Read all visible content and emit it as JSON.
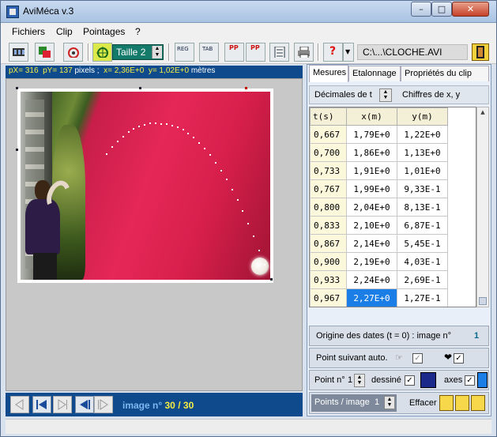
{
  "window": {
    "title": "AviMéca v.3"
  },
  "menu": {
    "items": [
      "Fichiers",
      "Clip",
      "Pointages",
      "?"
    ]
  },
  "toolbar": {
    "taille_label": "Taille",
    "taille_value": "2",
    "file_path": "C:\\...\\CLOCHE.AVI",
    "buttons": [
      "film-strip-icon",
      "copy-icon",
      "target-zoom-icon",
      "crosshair-icon",
      "reg-icon",
      "tab-icon",
      "pp-grid-icon",
      "pp-chart-icon",
      "document-icon",
      "print-icon",
      "help-icon",
      "dropdown-icon",
      "exit-door-icon"
    ],
    "reg_label": "REG",
    "tab_label": "TAB",
    "pp_label": "PP",
    "help_label": "?"
  },
  "coords": {
    "px_label": "pX=",
    "px": "316",
    "py_label": "pY=",
    "py": "137",
    "px_unit": "pixels",
    "separator": ";",
    "x_label": "x=",
    "x": "2,36E+0",
    "y_label": "y=",
    "y": "1,02E+0",
    "xy_unit": "mètres"
  },
  "navigation": {
    "image_label": "image n°",
    "current": "30",
    "separator": "/",
    "total": "30"
  },
  "panel": {
    "tabs": [
      "Mesures",
      "Etalonnage",
      "Propriétés du clip"
    ],
    "active_tab": "Mesures",
    "decimales_label": "Décimales de t",
    "chiffres_label": "Chiffres de x, y",
    "table": {
      "headers": [
        "t(s)",
        "x(m)",
        "y(m)"
      ],
      "rows": [
        [
          "0,667",
          "1,79E+0",
          "1,22E+0"
        ],
        [
          "0,700",
          "1,86E+0",
          "1,13E+0"
        ],
        [
          "0,733",
          "1,91E+0",
          "1,01E+0"
        ],
        [
          "0,767",
          "1,99E+0",
          "9,33E-1"
        ],
        [
          "0,800",
          "2,04E+0",
          "8,13E-1"
        ],
        [
          "0,833",
          "2,10E+0",
          "6,87E-1"
        ],
        [
          "0,867",
          "2,14E+0",
          "5,45E-1"
        ],
        [
          "0,900",
          "2,19E+0",
          "4,03E-1"
        ],
        [
          "0,933",
          "2,24E+0",
          "2,69E-1"
        ],
        [
          "0,967",
          "2,27E+0",
          "1,27E-1"
        ]
      ],
      "selected_cell": "2,27E+0"
    },
    "origine": {
      "label": "Origine des dates (t = 0) : image n°",
      "value": "1"
    },
    "point_suivant": {
      "label": "Point suivant auto.",
      "checked": true
    },
    "point": {
      "label": "Point n°",
      "value": "1",
      "dessine_label": "dessiné",
      "dessine_checked": true,
      "axes_label": "axes",
      "axes_checked": true
    },
    "points_per_image": {
      "label": "Points / image",
      "value": "1"
    },
    "effacer_label": "Effacer"
  },
  "colors": {
    "accent_blue": "#0e4a8c",
    "coord_highlight": "#f6ee42",
    "selected_cell": "#1a7ee6",
    "curtain_red": "#e52757",
    "taille_bg": "#147a6a"
  }
}
